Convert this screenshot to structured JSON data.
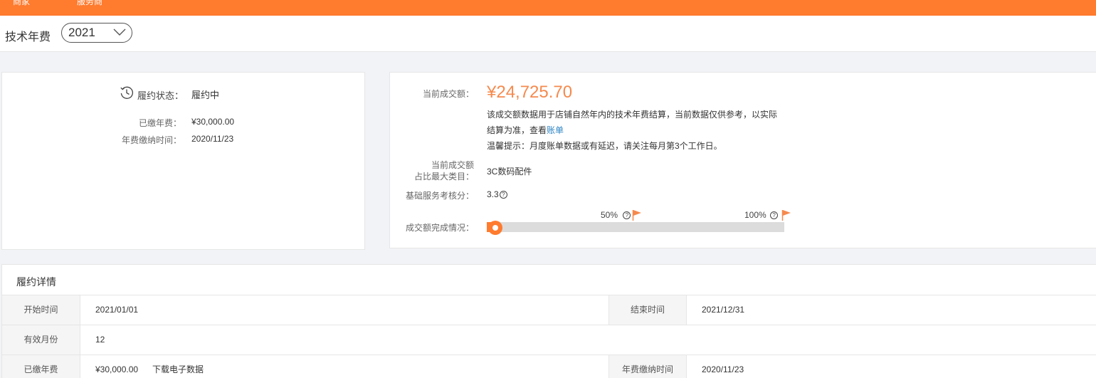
{
  "nav": {
    "item1": "商家",
    "item2": "服务商"
  },
  "header": {
    "title": "技术年费",
    "year": "2021"
  },
  "fulfillment": {
    "status_label": "履约状态：",
    "status_value": "履约中",
    "paid_label": "已缴年费：",
    "paid_value": "¥30,000.00",
    "paytime_label": "年费缴纳时间：",
    "paytime_value": "2020/11/23"
  },
  "sales": {
    "current_label": "当前成交额：",
    "current_value": "¥24,725.70",
    "desc1": "该成交额数据用于店铺自然年内的技术年费结算，当前数据仅供参考，以实际",
    "desc2_prefix": "结算为准，查看",
    "desc2_link": "账单",
    "tip": "温馨提示：月度账单数据或有延迟，请关注每月第3个工作日。",
    "category_label_1": "当前成交额",
    "category_label_2": "占比最大类目：",
    "category_value": "3C数码配件",
    "score_label": "基础服务考核分：",
    "score_value": "3.3",
    "progress_label": "成交额完成情况：",
    "progress_fraction": 0.04,
    "marker_50": "50%",
    "marker_100": "100%"
  },
  "detail": {
    "title": "履约详情",
    "start_label": "开始时间",
    "start_value": "2021/01/01",
    "end_label": "结束时间",
    "end_value": "2021/12/31",
    "months_label": "有效月份",
    "months_value": "12",
    "paid_label": "已缴年费",
    "paid_value": "¥30,000.00",
    "download_link": "下载电子数据",
    "paytime_label": "年费缴纳时间",
    "paytime_value": "2020/11/23"
  },
  "colors": {
    "accent": "#ff7b2e",
    "amount": "#f58a4e",
    "link": "#2f86c4"
  },
  "icons": {
    "status": "history-clock-icon",
    "chevron": "chevron-down-icon",
    "help": "question-circle-icon",
    "flag": "flag-icon"
  }
}
